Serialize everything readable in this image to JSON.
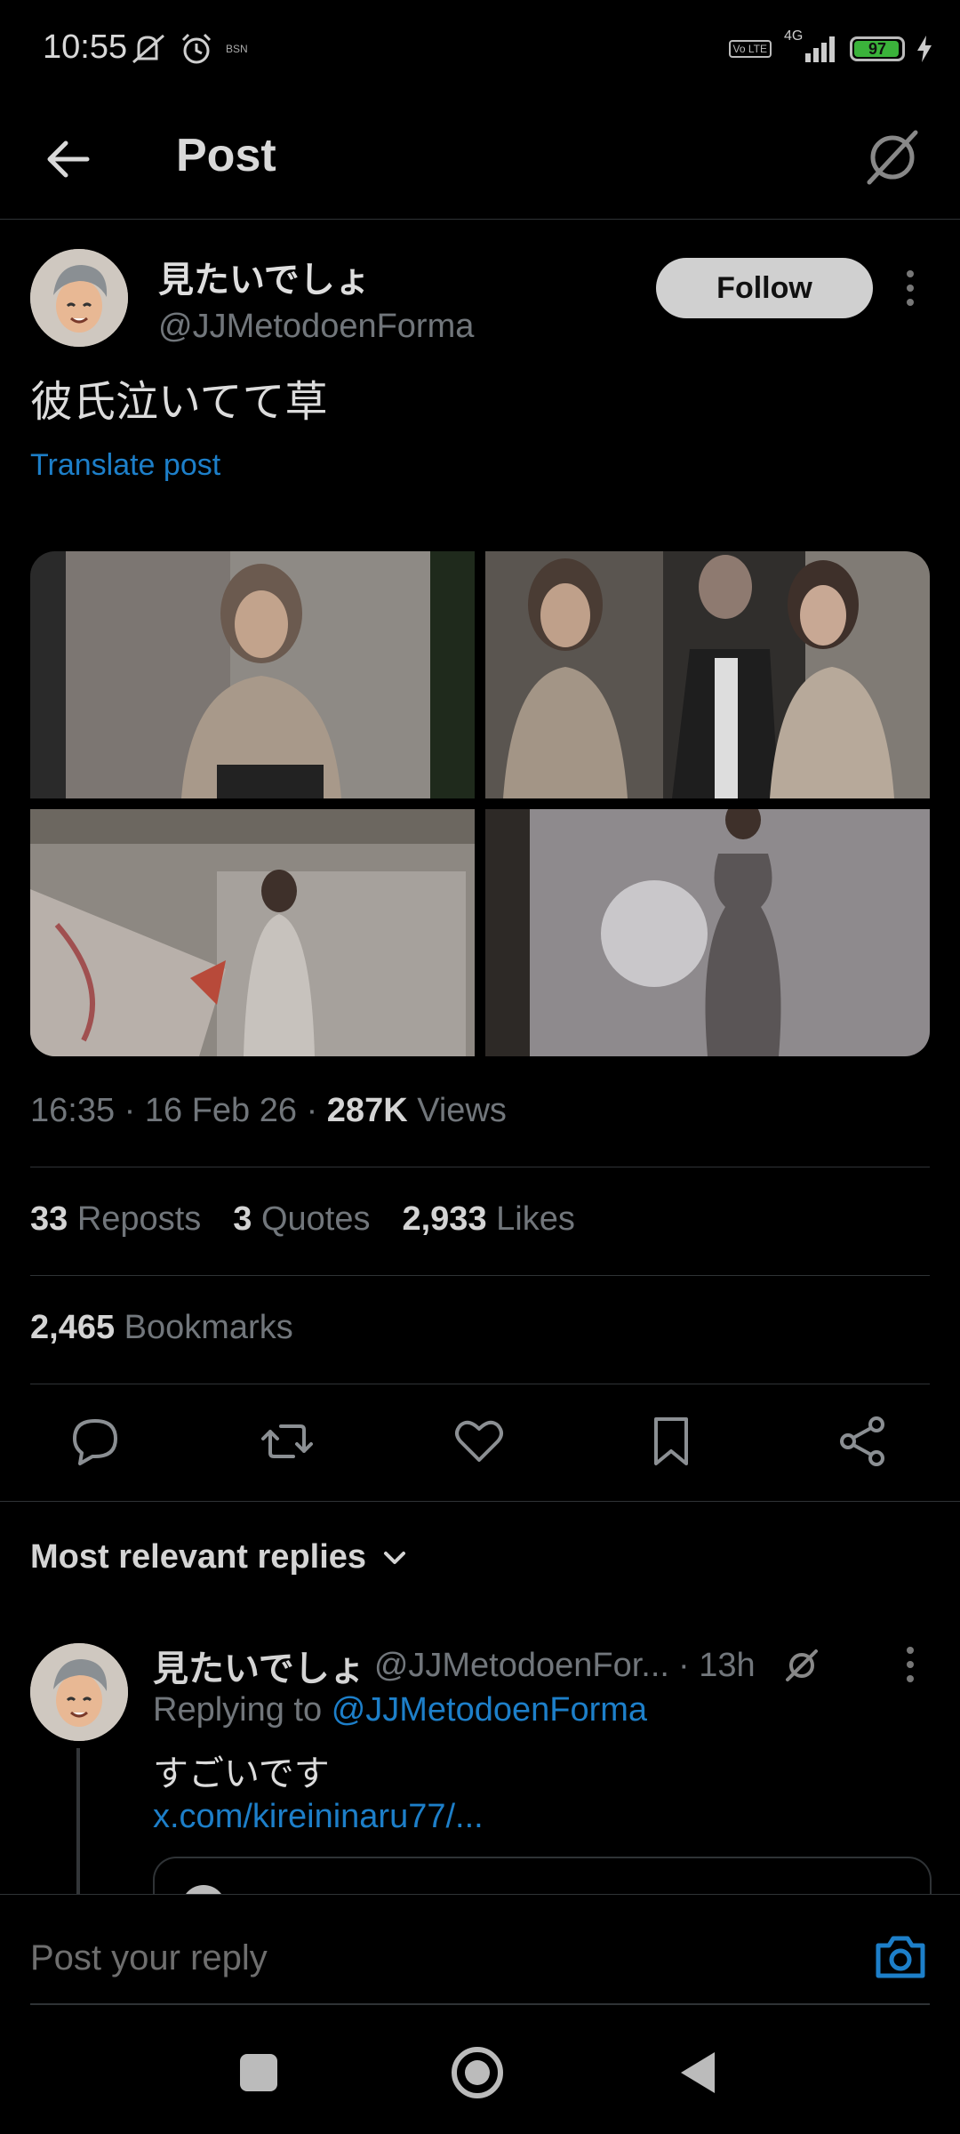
{
  "status_bar": {
    "time": "10:55",
    "network_label": "4G",
    "lte_label": "Vo LTE",
    "carrier_mini": "BSN",
    "battery_level": 97,
    "battery_label": "97"
  },
  "header": {
    "title": "Post"
  },
  "post": {
    "display_name": "見たいでしょ",
    "handle": "@JJMetodoenForma",
    "follow_label": "Follow",
    "text": "彼氏泣いてて草",
    "translate_label": "Translate post",
    "time": "16:35",
    "date": "16 Feb 26",
    "views_count": "287K",
    "views_label": "Views",
    "reposts_count": "33",
    "reposts_label": "Reposts",
    "quotes_count": "3",
    "quotes_label": "Quotes",
    "likes_count": "2,933",
    "likes_label": "Likes",
    "bookmarks_count": "2,465",
    "bookmarks_label": "Bookmarks",
    "media_count": 4
  },
  "actions": [
    "reply-icon",
    "repost-icon",
    "like-icon",
    "bookmark-icon",
    "share-icon"
  ],
  "replies": {
    "sort_label": "Most relevant replies",
    "items": [
      {
        "display_name": "見たいでしょ",
        "handle": "@JJMetodoenFor...",
        "age": "· 13h",
        "replying_prefix": "Replying to",
        "replying_to": "@JJMetodoenForma",
        "text": "すごいです",
        "link": "x.com/kireininaru77/..."
      }
    ]
  },
  "composer": {
    "placeholder": "Post your reply"
  },
  "colors": {
    "background": "#000000",
    "link": "#1d7fc9",
    "muted": "#71767b",
    "battery": "#3bb33b"
  }
}
